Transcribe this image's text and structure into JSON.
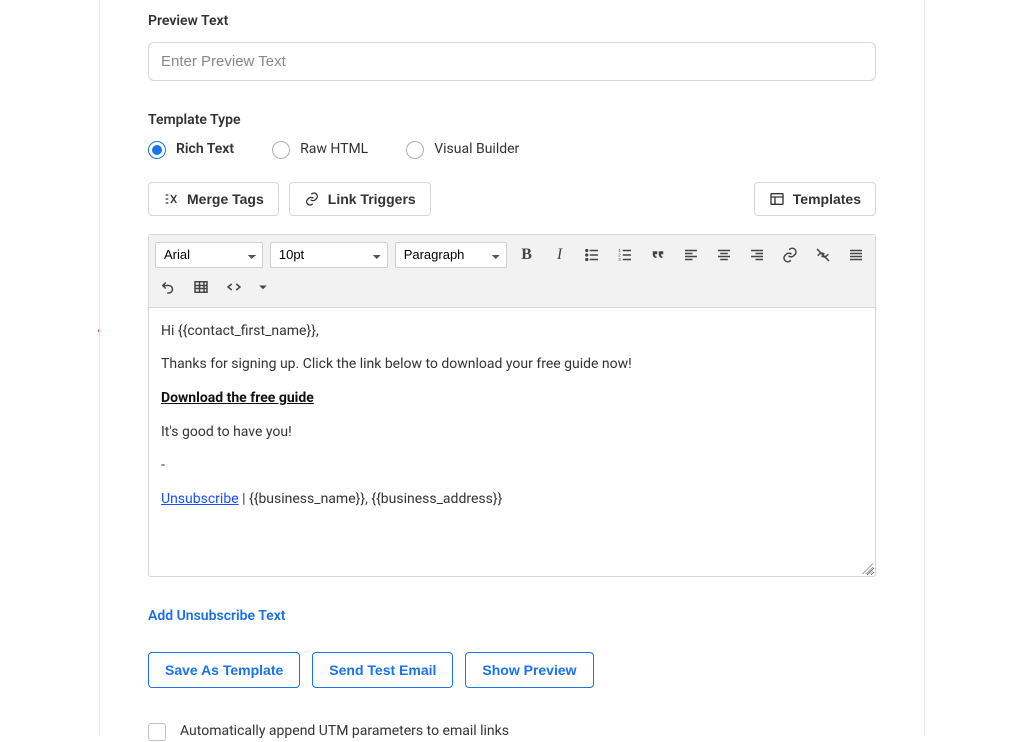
{
  "previewText": {
    "label": "Preview Text",
    "placeholder": "Enter Preview Text"
  },
  "templateType": {
    "label": "Template Type",
    "options": [
      "Rich Text",
      "Raw HTML",
      "Visual Builder"
    ],
    "selectedIndex": 0
  },
  "toolbar": {
    "mergeTags": "Merge Tags",
    "linkTriggers": "Link Triggers",
    "templates": "Templates"
  },
  "editor": {
    "font": "Arial",
    "size": "10pt",
    "style": "Paragraph",
    "body": {
      "greeting": "Hi {{contact_first_name}},",
      "line2": "Thanks for signing up. Click the link below to download your free guide now!",
      "downloadLink": "Download the free guide",
      "line4": "It's good to have you!",
      "dash": "-",
      "unsub": "Unsubscribe",
      "footerRest": " | {{business_name}}, {{business_address}}"
    }
  },
  "links": {
    "addUnsub": "Add Unsubscribe Text"
  },
  "buttons": {
    "saveAsTemplate": "Save As Template",
    "sendTest": "Send Test Email",
    "showPreview": "Show Preview"
  },
  "utm": {
    "label": "Automatically append UTM parameters to email links"
  }
}
